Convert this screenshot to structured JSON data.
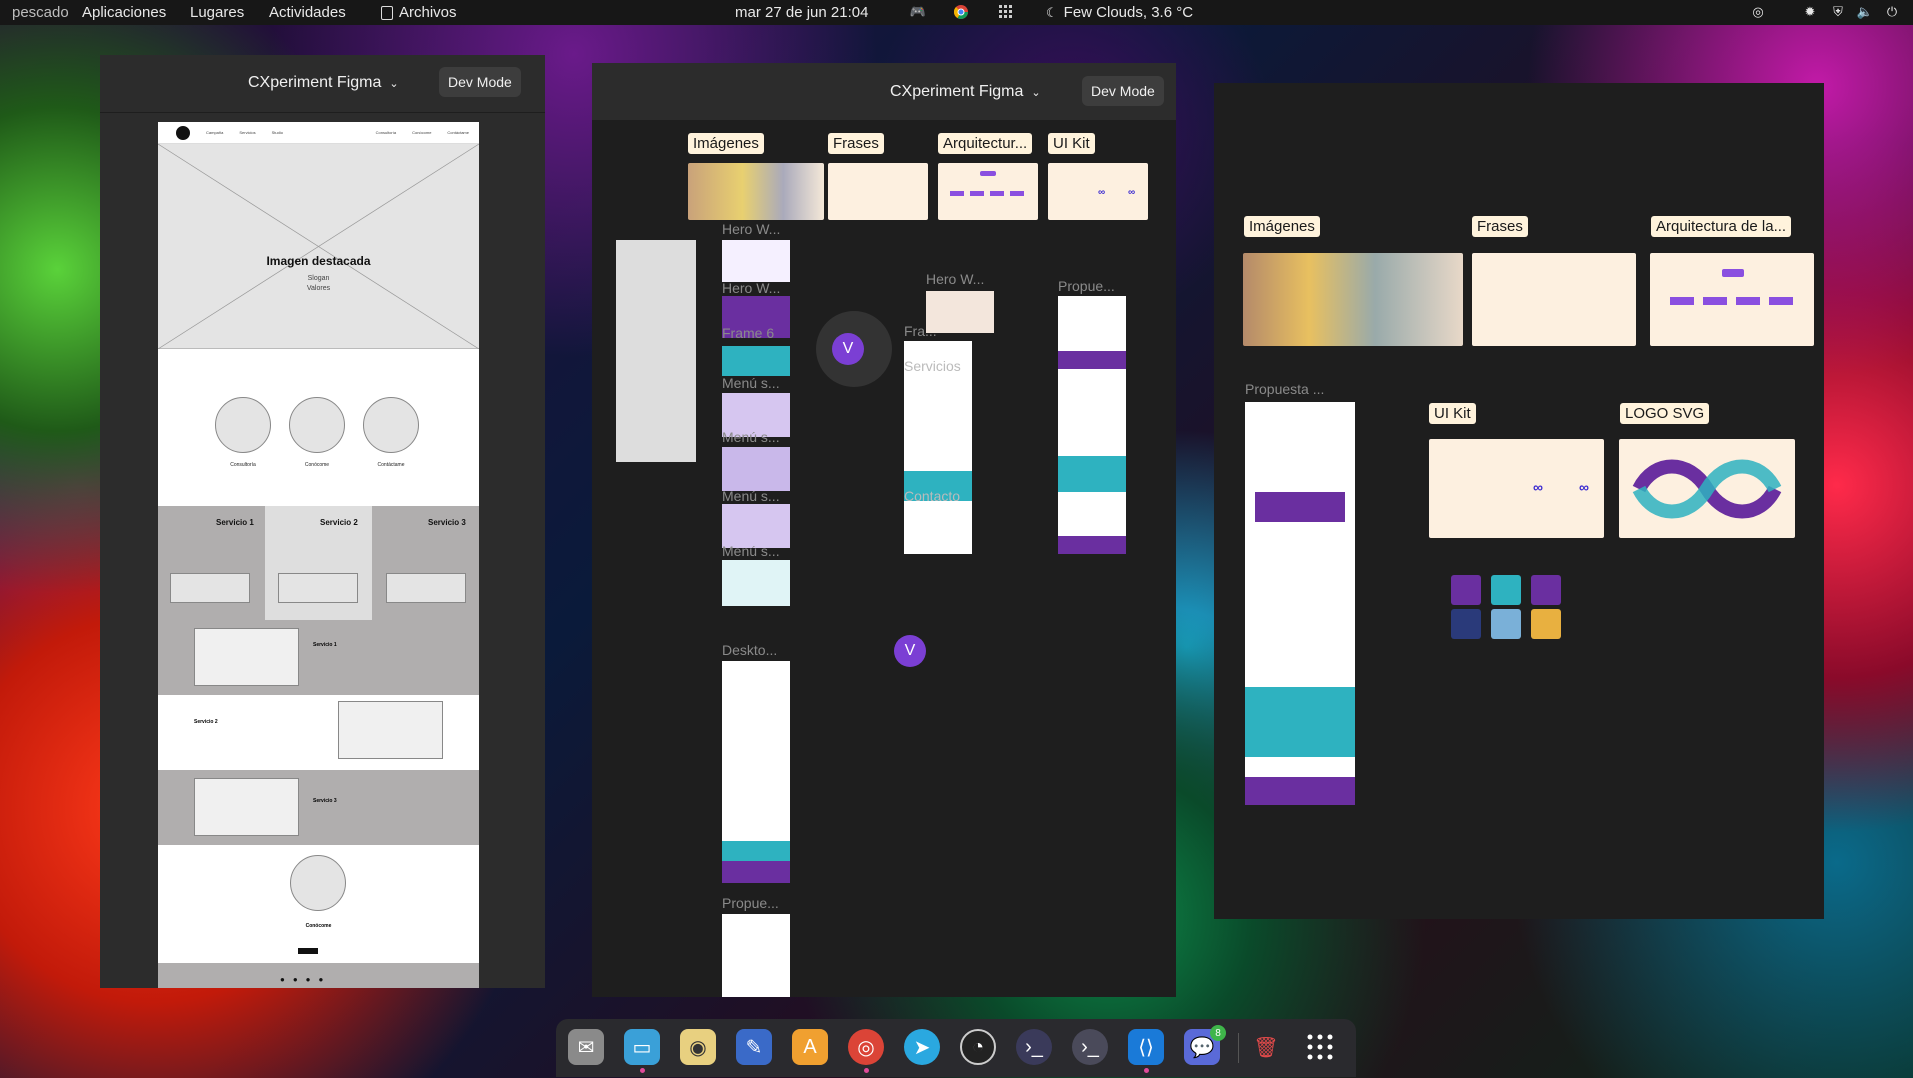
{
  "topbar": {
    "user": "pescado",
    "apps": "Aplicaciones",
    "places": "Lugares",
    "activities": "Actividades",
    "files": "Archivos",
    "clock": "mar 27 de jun  21:04",
    "weather": "Few Clouds, 3.6 °C"
  },
  "window1": {
    "project": "CXperiment Figma",
    "dev_mode": "Dev Mode",
    "wireframe": {
      "nav_links": [
        "Campaña",
        "Servicios",
        "Studio"
      ],
      "nav_right": [
        "Consultoría",
        "Conócome",
        "Contáctame"
      ],
      "hero_title": "Imagen destacada",
      "hero_slogan": "Slogan",
      "hero_values": "Valores",
      "circles": [
        "Consultoría",
        "Conócome",
        "Contáctame"
      ],
      "services": [
        "Servicio 1",
        "Servicio 2",
        "Servicio 3"
      ],
      "rows": [
        "Servicio 1",
        "Servicio 2",
        "Servicio 3"
      ],
      "about": "Conócome"
    }
  },
  "window2": {
    "project": "CXperiment Figma",
    "dev_mode": "Dev Mode",
    "sections": [
      "Imágenes",
      "Frases",
      "Arquitectur...",
      "UI Kit"
    ],
    "frames": [
      "Hero W...",
      "Hero W...",
      "Frame 6",
      "Menú s...",
      "Menú s...",
      "Menú s...",
      "Menú s...",
      "Deskto...",
      "Propue...",
      "Hero W...",
      "Fra...",
      "Propue...",
      "Servicios",
      "Contacto"
    ],
    "avatar": "V"
  },
  "window3": {
    "sections": [
      "Imágenes",
      "Frases",
      "Arquitectura de la...",
      "UI Kit",
      "LOGO SVG"
    ],
    "frame": "Propuesta ..."
  },
  "dock": {
    "badge": "8"
  }
}
